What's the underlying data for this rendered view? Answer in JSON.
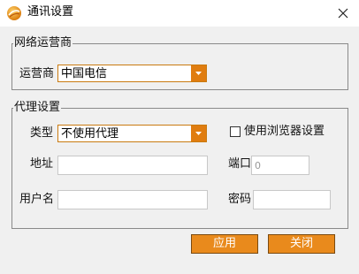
{
  "window": {
    "title": "通讯设置",
    "icon": "app-logo-icon",
    "close_icon": "close-icon"
  },
  "network_group": {
    "legend": "网络运营商",
    "carrier_label": "运营商",
    "carrier_value": "中国电信"
  },
  "proxy_group": {
    "legend": "代理设置",
    "type_label": "类型",
    "type_value": "不使用代理",
    "use_browser_label": "使用浏览器设置",
    "use_browser_checked": false,
    "address_label": "地址",
    "address_value": "",
    "port_label": "端口",
    "port_value": "0",
    "username_label": "用户名",
    "username_value": "",
    "password_label": "密码",
    "password_value": ""
  },
  "buttons": {
    "apply": "应用",
    "close": "关闭"
  },
  "colors": {
    "accent": "#e98a1c",
    "dropdown_border": "#c97a10",
    "dialog_bg": "#f0f0f0"
  }
}
